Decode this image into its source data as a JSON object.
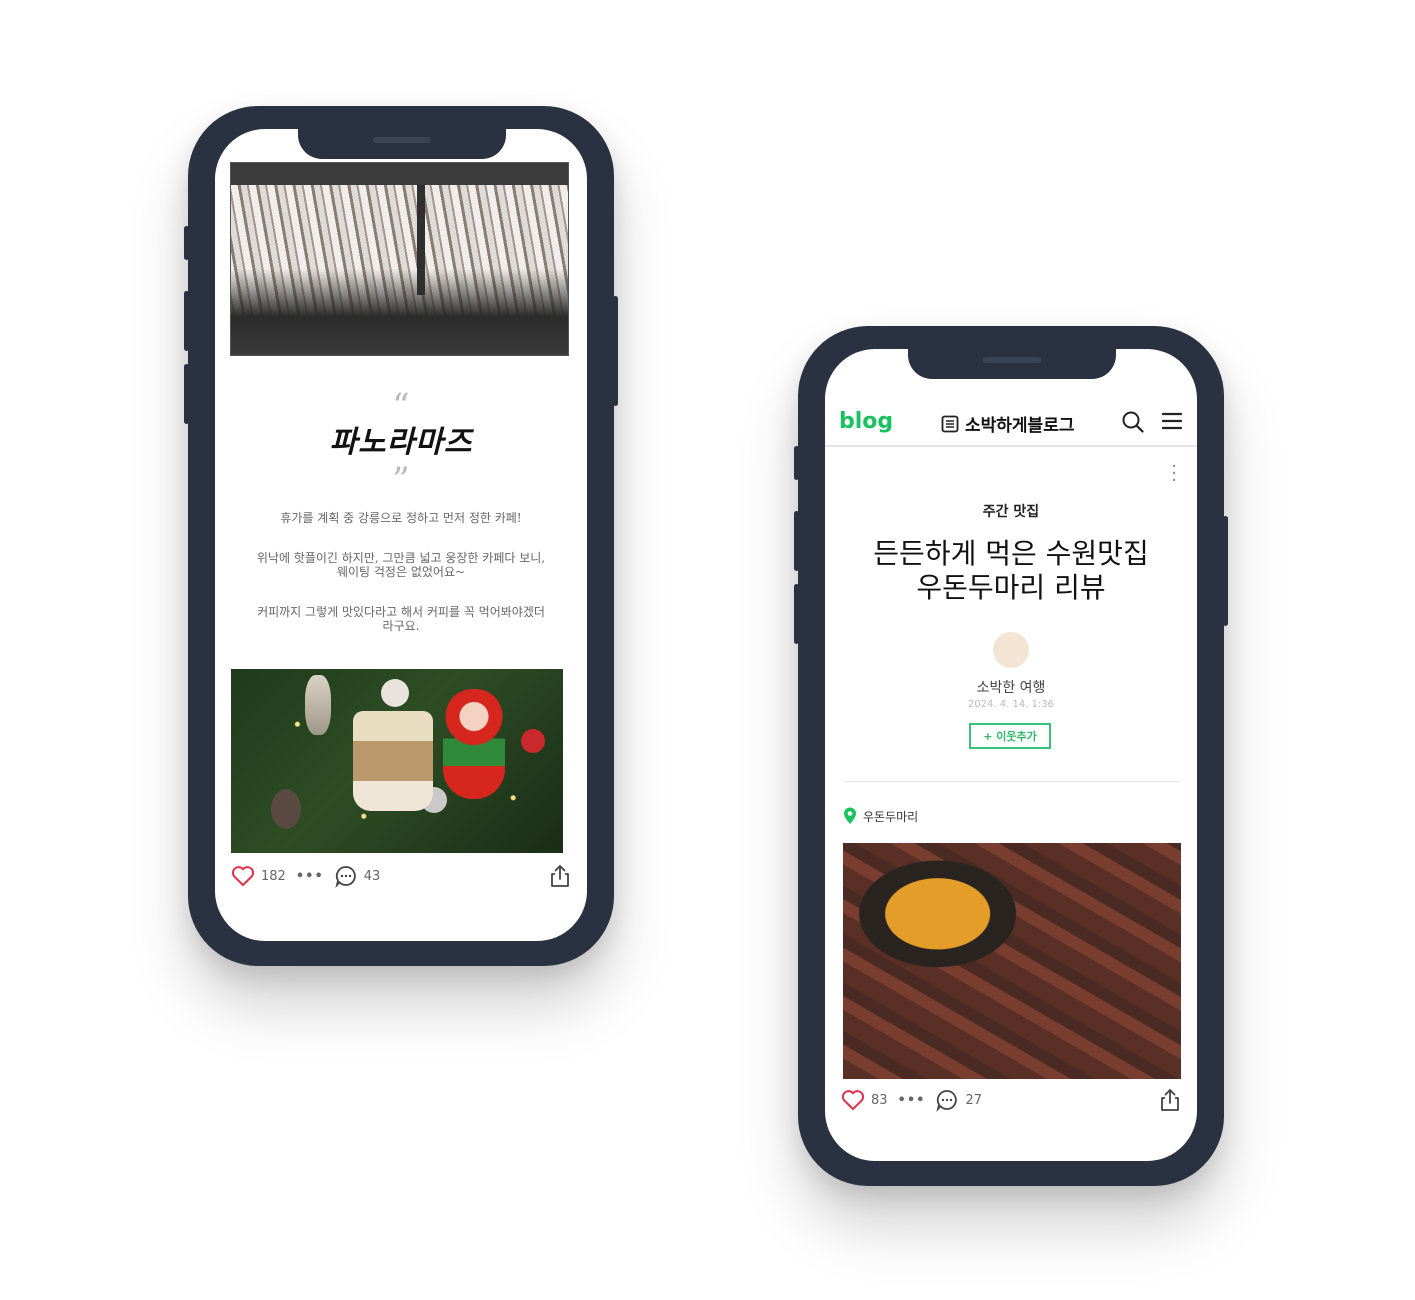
{
  "left_phone": {
    "post_title": "파노라마즈",
    "quote_open": "“",
    "quote_close": "”",
    "paragraphs": [
      "휴가를 계획 중 강릉으로 정하고 먼저 정한 카페!",
      "위낙에 핫플이긴 하지만, 그만큼 넓고 웅장한 카페다 보니, 웨이팅 걱정은 없었어요~",
      "커피까지 그렇게 맛있다라고 해서 커피를 꼭 먹어봐야겠더라구요."
    ],
    "actions": {
      "likes": "182",
      "more": "•••",
      "comments": "43"
    }
  },
  "right_phone": {
    "header": {
      "logo": "blog",
      "blog_name": "소박하게블로그"
    },
    "category": "주간 맛집",
    "post_title_line1": "든든하게 먹은 수원맛집",
    "post_title_line2": "우돈두마리 리뷰",
    "author": "소박한 여행",
    "date": "2024. 4. 14. 1:36",
    "neighbor_button": "+ 이웃추가",
    "place": "우돈두마리",
    "actions": {
      "likes": "83",
      "more": "•••",
      "comments": "27"
    }
  },
  "colors": {
    "phone_frame": "#2a3140",
    "naver_green": "#19c25e",
    "like_heart": "#e0344a"
  }
}
